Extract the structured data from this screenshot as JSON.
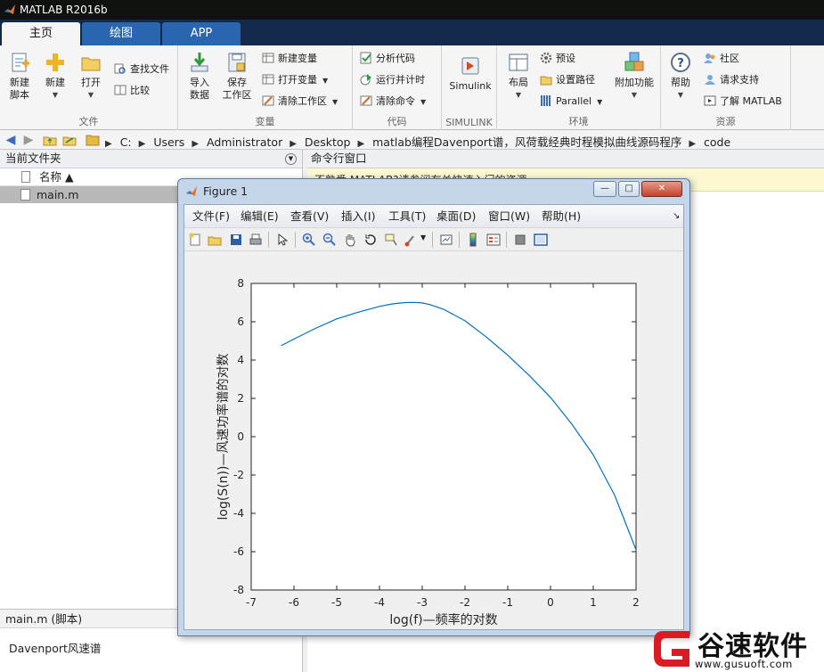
{
  "app": {
    "title": "MATLAB R2016b"
  },
  "tabs": [
    "主页",
    "绘图",
    "APP"
  ],
  "ribbon": {
    "file": {
      "caption": "文件",
      "new_script": "新建\n脚本",
      "new": "新建",
      "open": "打开",
      "find_files": "查找文件",
      "compare": "比较"
    },
    "variable": {
      "caption": "变量",
      "import": "导入\n数据",
      "save_workspace": "保存\n工作区",
      "new_variable": "新建变量",
      "open_variable": "打开变量",
      "clear_workspace": "清除工作区"
    },
    "code": {
      "caption": "代码",
      "analyze": "分析代码",
      "run_time": "运行并计时",
      "clear_commands": "清除命令"
    },
    "simulink": {
      "caption": "SIMULINK",
      "label": "Simulink"
    },
    "environment": {
      "caption": "环境",
      "layout": "布局",
      "preferences": "预设",
      "set_path": "设置路径",
      "parallel": "Parallel",
      "addons": "附加功能"
    },
    "resources": {
      "caption": "资源",
      "help": "帮助",
      "community": "社区",
      "request_support": "请求支持",
      "learn_matlab": "了解 MATLAB"
    }
  },
  "address": {
    "crumbs": [
      "C:",
      "Users",
      "Administrator",
      "Desktop",
      "matlab编程Davenport谱，风荷载经典时程模拟曲线源码程序",
      "code"
    ]
  },
  "left_panel": {
    "title": "当前文件夹",
    "column_name": "名称 ▲",
    "files": [
      "main.m"
    ],
    "detail_title": "main.m  (脚本)",
    "detail_text": "Davenport风速谱"
  },
  "command_window": {
    "title": "命令行窗口",
    "banner": "不熟悉 MATLAB?请参阅有关快速入门的资源。"
  },
  "figure": {
    "title": "Figure 1",
    "menu": [
      "文件(F)",
      "编辑(E)",
      "查看(V)",
      "插入(I)",
      "工具(T)",
      "桌面(D)",
      "窗口(W)",
      "帮助(H)"
    ]
  },
  "chart_data": {
    "type": "line",
    "xlabel": "log(f)—频率的对数",
    "ylabel": "log(S(n))—风速功率谱的对数",
    "xlim": [
      -7,
      2
    ],
    "ylim": [
      -8,
      8
    ],
    "xticks": [
      -7,
      -6,
      -5,
      -4,
      -3,
      -2,
      -1,
      0,
      1,
      2
    ],
    "yticks": [
      -8,
      -6,
      -4,
      -2,
      0,
      2,
      4,
      6,
      8
    ],
    "grid": false,
    "color": "#0072bd",
    "series": [
      {
        "x": [
          -6.3,
          -6.0,
          -5.5,
          -5.0,
          -4.5,
          -4.0,
          -3.7,
          -3.4,
          -3.2,
          -3.0,
          -2.8,
          -2.5,
          -2.0,
          -1.5,
          -1.0,
          -0.5,
          0.0,
          0.5,
          1.0,
          1.5,
          2.0
        ],
        "y": [
          4.75,
          5.1,
          5.65,
          6.15,
          6.5,
          6.8,
          6.93,
          7.0,
          7.01,
          6.98,
          6.88,
          6.65,
          6.05,
          5.2,
          4.25,
          3.2,
          2.05,
          0.65,
          -0.95,
          -3.05,
          -5.9
        ]
      }
    ]
  },
  "watermark": {
    "text": "谷速软件",
    "url": "www.gusuoft.com"
  }
}
